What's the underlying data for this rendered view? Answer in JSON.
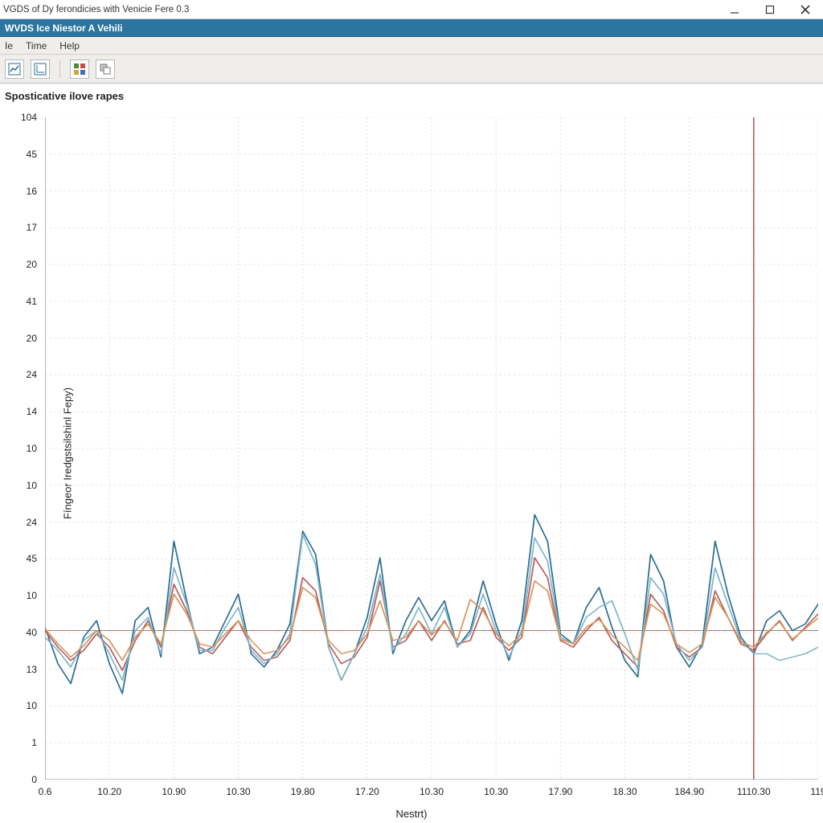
{
  "window": {
    "title": "VGDS of Dy ferondicies with Venicie Fere 0.3",
    "subtitle": "WVDS Ice Niestor A Vehili"
  },
  "menu": {
    "items": [
      "Ie",
      "Time",
      "Help"
    ]
  },
  "toolbar": {
    "icons": [
      "chart-window-icon",
      "axes-window-icon",
      "palette-icon",
      "layers-icon"
    ]
  },
  "chart_data": {
    "type": "line",
    "title": "Sposticative ilove rapes",
    "xlabel": "Nestrt)",
    "ylabel": "Fíngeor Iredgstsilshinl Fepy)",
    "y_ticks": [
      "104",
      "45",
      "16",
      "17",
      "20",
      "41",
      "20",
      "24",
      "14",
      "10",
      "10",
      "24",
      "45",
      "10",
      "40",
      "13",
      "10",
      "1",
      "0"
    ],
    "x_ticks": [
      "0.6",
      "10.20",
      "10.90",
      "10.30",
      "19.80",
      "17.20",
      "10.30",
      "10.30",
      "17.90",
      "18.30",
      "184.90",
      "1110.30",
      "119"
    ],
    "cursor_x_index": 11,
    "hline_frac": 0.775,
    "ylim_frac": [
      0,
      1
    ],
    "series": [
      {
        "name": "series-a",
        "color": "#2a6d93",
        "y_frac": [
          0.77,
          0.825,
          0.855,
          0.785,
          0.76,
          0.825,
          0.87,
          0.76,
          0.74,
          0.815,
          0.64,
          0.73,
          0.81,
          0.8,
          0.76,
          0.72,
          0.81,
          0.83,
          0.805,
          0.765,
          0.625,
          0.66,
          0.8,
          0.85,
          0.81,
          0.755,
          0.665,
          0.81,
          0.76,
          0.725,
          0.76,
          0.73,
          0.8,
          0.775,
          0.7,
          0.765,
          0.82,
          0.76,
          0.6,
          0.64,
          0.78,
          0.795,
          0.74,
          0.71,
          0.77,
          0.82,
          0.845,
          0.66,
          0.7,
          0.8,
          0.83,
          0.795,
          0.64,
          0.72,
          0.785,
          0.81,
          0.76,
          0.745,
          0.775,
          0.765,
          0.735
        ]
      },
      {
        "name": "series-b",
        "color": "#b85b5a",
        "y_frac": [
          0.775,
          0.8,
          0.82,
          0.805,
          0.78,
          0.8,
          0.835,
          0.79,
          0.76,
          0.8,
          0.705,
          0.745,
          0.8,
          0.81,
          0.785,
          0.76,
          0.8,
          0.82,
          0.815,
          0.79,
          0.695,
          0.715,
          0.795,
          0.825,
          0.815,
          0.785,
          0.7,
          0.8,
          0.79,
          0.76,
          0.79,
          0.76,
          0.795,
          0.79,
          0.74,
          0.785,
          0.805,
          0.785,
          0.665,
          0.695,
          0.79,
          0.8,
          0.775,
          0.755,
          0.79,
          0.81,
          0.83,
          0.72,
          0.745,
          0.8,
          0.815,
          0.8,
          0.715,
          0.755,
          0.795,
          0.805,
          0.78,
          0.76,
          0.79,
          0.77,
          0.75
        ]
      },
      {
        "name": "series-c",
        "color": "#7fb5c9",
        "y_frac": [
          0.785,
          0.805,
          0.83,
          0.79,
          0.775,
          0.81,
          0.85,
          0.775,
          0.755,
          0.81,
          0.68,
          0.735,
          0.805,
          0.805,
          0.77,
          0.74,
          0.805,
          0.825,
          0.81,
          0.78,
          0.63,
          0.675,
          0.8,
          0.85,
          0.81,
          0.77,
          0.69,
          0.805,
          0.78,
          0.74,
          0.78,
          0.74,
          0.8,
          0.78,
          0.72,
          0.775,
          0.815,
          0.775,
          0.635,
          0.67,
          0.785,
          0.795,
          0.755,
          0.74,
          0.73,
          0.78,
          0.835,
          0.695,
          0.72,
          0.795,
          0.82,
          0.8,
          0.68,
          0.735,
          0.79,
          0.81,
          0.81,
          0.82,
          0.815,
          0.81,
          0.8
        ]
      },
      {
        "name": "series-d",
        "color": "#d5955a",
        "y_frac": [
          0.772,
          0.795,
          0.815,
          0.798,
          0.775,
          0.79,
          0.82,
          0.785,
          0.765,
          0.795,
          0.72,
          0.75,
          0.795,
          0.8,
          0.78,
          0.76,
          0.79,
          0.81,
          0.805,
          0.785,
          0.71,
          0.725,
          0.79,
          0.81,
          0.805,
          0.78,
          0.73,
          0.79,
          0.785,
          0.76,
          0.782,
          0.762,
          0.79,
          0.728,
          0.745,
          0.78,
          0.798,
          0.78,
          0.7,
          0.715,
          0.788,
          0.795,
          0.77,
          0.758,
          0.782,
          0.8,
          0.82,
          0.735,
          0.75,
          0.795,
          0.808,
          0.795,
          0.725,
          0.755,
          0.792,
          0.8,
          0.778,
          0.762,
          0.788,
          0.772,
          0.756
        ]
      }
    ]
  }
}
